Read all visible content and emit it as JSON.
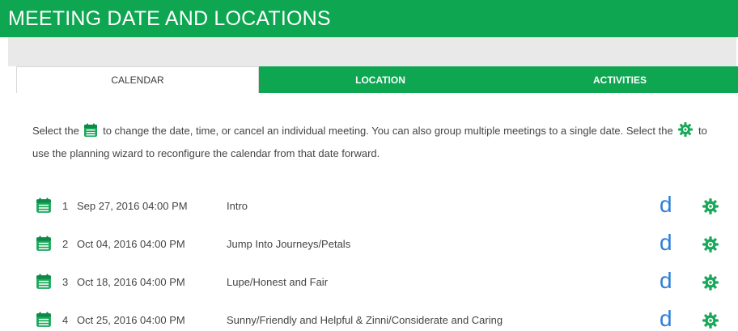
{
  "header": {
    "title": "MEETING DATE AND LOCATIONS"
  },
  "tabs": [
    {
      "label": "CALENDAR",
      "active": true
    },
    {
      "label": "LOCATION",
      "active": false
    },
    {
      "label": "ACTIVITIES",
      "active": false
    }
  ],
  "instructions": {
    "part1": "Select the",
    "part2": "to change the date, time, or cancel an individual meeting. You can also group multiple meetings to a single date. Select the",
    "part3": "to use the planning wizard to reconfigure the calendar from that date forward."
  },
  "meetings": [
    {
      "number": "1",
      "date": "Sep 27, 2016 04:00 PM",
      "title": "Intro",
      "d_label": "d"
    },
    {
      "number": "2",
      "date": "Oct 04, 2016 04:00 PM",
      "title": "Jump Into Journeys/Petals",
      "d_label": "d"
    },
    {
      "number": "3",
      "date": "Oct 18, 2016 04:00 PM",
      "title": "Lupe/Honest and Fair",
      "d_label": "d"
    },
    {
      "number": "4",
      "date": "Oct 25, 2016 04:00 PM",
      "title": "Sunny/Friendly and Helpful & Zinni/Considerate and Caring",
      "d_label": "d"
    }
  ],
  "icons": {
    "calendar": "calendar-icon",
    "gear": "gear-icon"
  },
  "colors": {
    "brand_green": "#0ea651",
    "link_blue": "#2e7fd8"
  }
}
